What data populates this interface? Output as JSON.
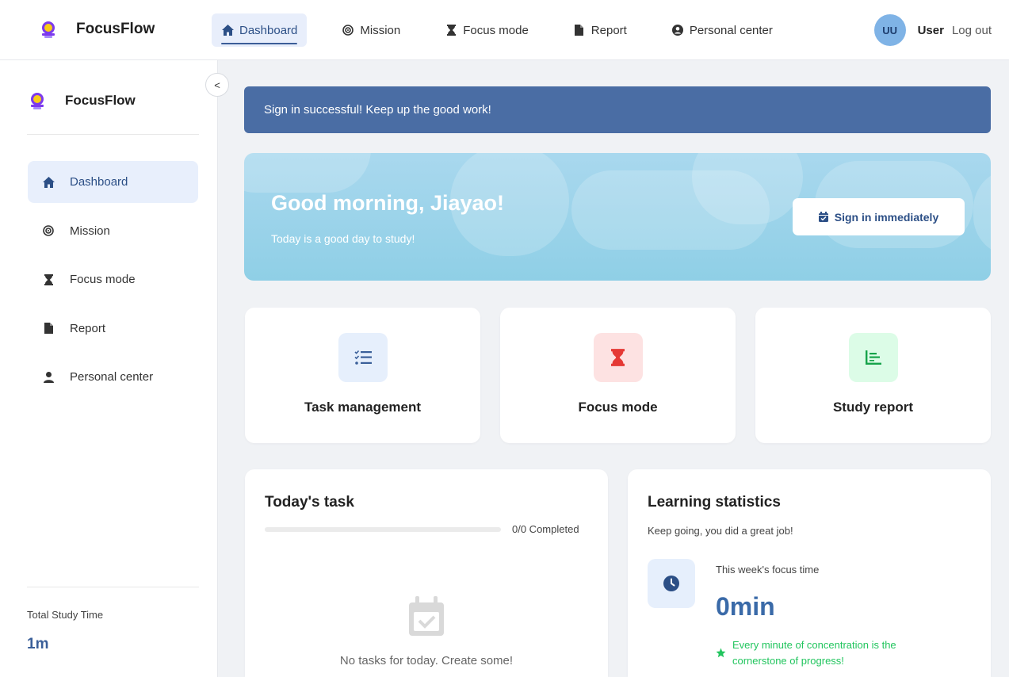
{
  "app": {
    "name": "FocusFlow"
  },
  "topnav": {
    "items": [
      {
        "label": "Dashboard",
        "icon": "home-icon",
        "active": true
      },
      {
        "label": "Mission",
        "icon": "target-icon"
      },
      {
        "label": "Focus mode",
        "icon": "hourglass-icon"
      },
      {
        "label": "Report",
        "icon": "file-icon"
      },
      {
        "label": "Personal center",
        "icon": "user-circle-icon"
      }
    ],
    "avatar_initials": "UU",
    "user_name": "User",
    "logout_label": "Log out"
  },
  "sidebar": {
    "brand": "FocusFlow",
    "collapse_glyph": "<",
    "items": [
      {
        "label": "Dashboard",
        "icon": "home-icon",
        "active": true
      },
      {
        "label": "Mission",
        "icon": "target-icon"
      },
      {
        "label": "Focus mode",
        "icon": "hourglass-icon"
      },
      {
        "label": "Report",
        "icon": "file-icon"
      },
      {
        "label": "Personal center",
        "icon": "user-icon"
      }
    ],
    "study_time_label": "Total Study Time",
    "study_time_value": "1m"
  },
  "alert": {
    "message": "Sign in successful! Keep up the good work!"
  },
  "hero": {
    "greeting": "Good morning, Jiayao!",
    "subtitle": "Today is a good day to study!",
    "signin_label": "Sign in immediately"
  },
  "quick_cards": [
    {
      "label": "Task management",
      "icon": "checklist-icon",
      "bg": "#e6effc",
      "color": "#3a5f99"
    },
    {
      "label": "Focus mode",
      "icon": "hourglass-icon",
      "bg": "#fde2e2",
      "color": "#e53935"
    },
    {
      "label": "Study report",
      "icon": "chart-icon",
      "bg": "#dcfce7",
      "color": "#16a34a"
    }
  ],
  "today_task": {
    "title": "Today's task",
    "progress_text": "0/0 Completed",
    "progress": 0,
    "empty_text": "No tasks for today. Create some!"
  },
  "stats": {
    "title": "Learning statistics",
    "subtitle": "Keep going, you did a great job!",
    "focus_label": "This week's focus time",
    "focus_value": "0min",
    "motto": "Every minute of concentration is the cornerstone of progress!"
  },
  "colors": {
    "primary": "#4a6da4",
    "accent_green": "#22c55e",
    "hero_bg": "#9fd5ec"
  }
}
